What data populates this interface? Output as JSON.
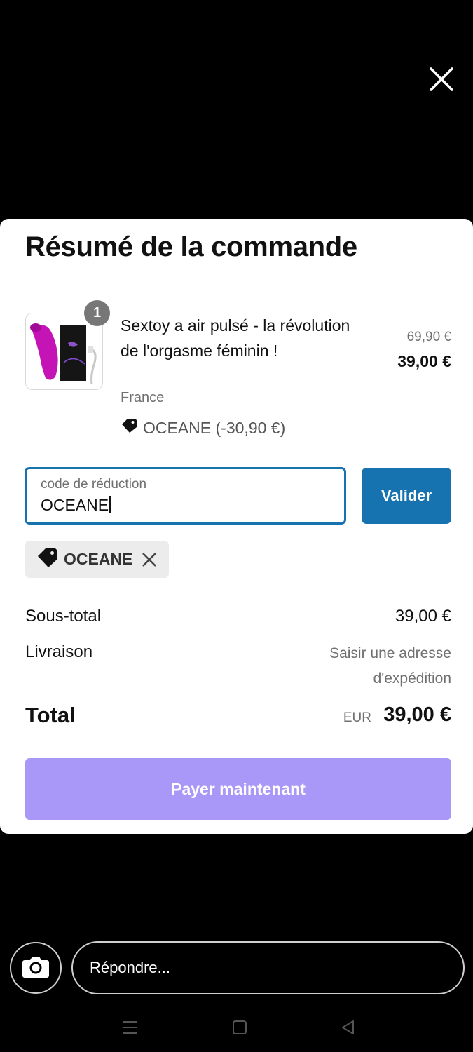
{
  "summary": {
    "title": "Résumé de la commande"
  },
  "product": {
    "quantity": "1",
    "name": "Sextoy a air pulsé - la révolution de l'orgasme féminin !",
    "variant": "France",
    "discount_line": "OCEANE (-30,90 €)",
    "old_price": "69,90 €",
    "price": "39,00 €"
  },
  "discount_form": {
    "label": "code de réduction",
    "value": "OCEANE",
    "apply_label": "Valider"
  },
  "applied_code": {
    "code": "OCEANE"
  },
  "totals": {
    "subtotal_label": "Sous-total",
    "subtotal_value": "39,00 €",
    "shipping_label": "Livraison",
    "shipping_value": "Saisir une adresse d'expédition",
    "total_label": "Total",
    "currency": "EUR",
    "total_value": "39,00 €"
  },
  "pay_button": {
    "label": "Payer maintenant",
    "color": "#a998f7"
  },
  "reply": {
    "placeholder": "Répondre..."
  },
  "colors": {
    "accent": "#1773b0",
    "background": "#000000",
    "sheet": "#ffffff"
  },
  "icons": {
    "close": "close-icon",
    "tag": "tag-icon",
    "camera": "camera-icon",
    "menu": "menu-icon",
    "home": "home-icon",
    "back": "back-icon"
  }
}
